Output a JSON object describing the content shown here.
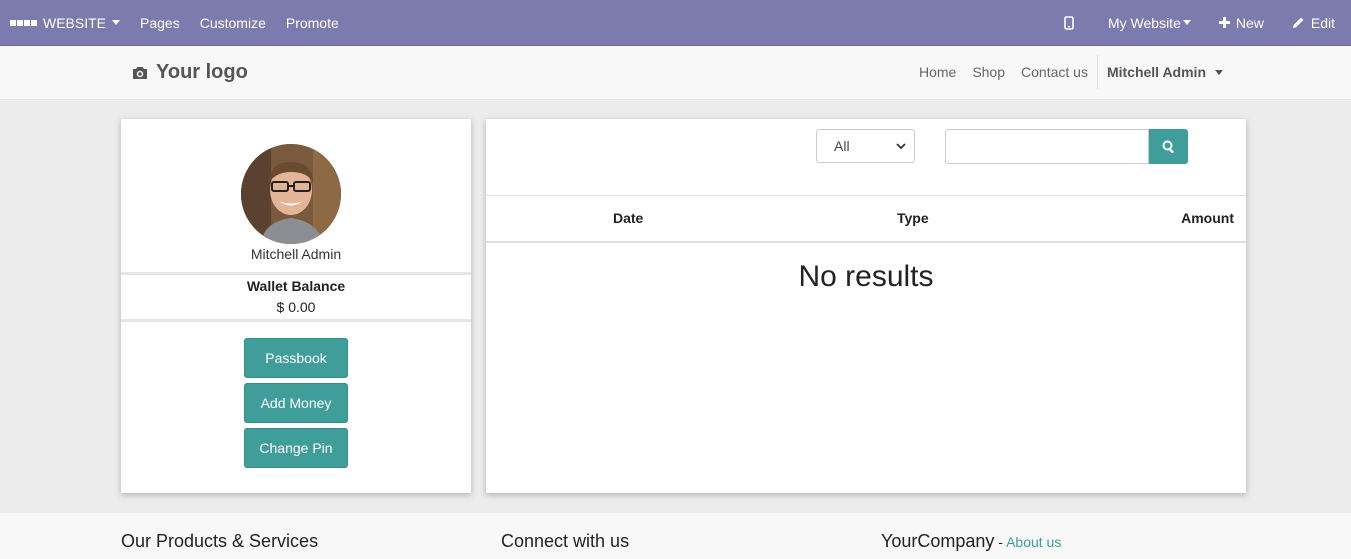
{
  "adminbar": {
    "app_label": "WEBSITE",
    "pages": "Pages",
    "customize": "Customize",
    "promote": "Promote",
    "website_selector": "My Website",
    "new_label": "New",
    "edit_label": "Edit"
  },
  "header": {
    "logo_text": "Your logo",
    "nav": [
      "Home",
      "Shop",
      "Contact us"
    ],
    "user": "Mitchell Admin"
  },
  "profile": {
    "name": "Mitchell Admin",
    "wallet_title": "Wallet Balance",
    "wallet_amount": "$ 0.00",
    "buttons": [
      "Passbook",
      "Add Money",
      "Change Pin"
    ]
  },
  "transactions": {
    "filter_value": "All",
    "search_value": "",
    "columns": [
      "Date",
      "Type",
      "Amount"
    ],
    "empty_text": "No results"
  },
  "footer": {
    "col1": "Our Products & Services",
    "col2": "Connect with us",
    "col3_title": "YourCompany",
    "col3_sep": " - ",
    "col3_link": "About us"
  },
  "colors": {
    "adminbar": "#7c7bad",
    "accent": "#3f9e9a"
  }
}
